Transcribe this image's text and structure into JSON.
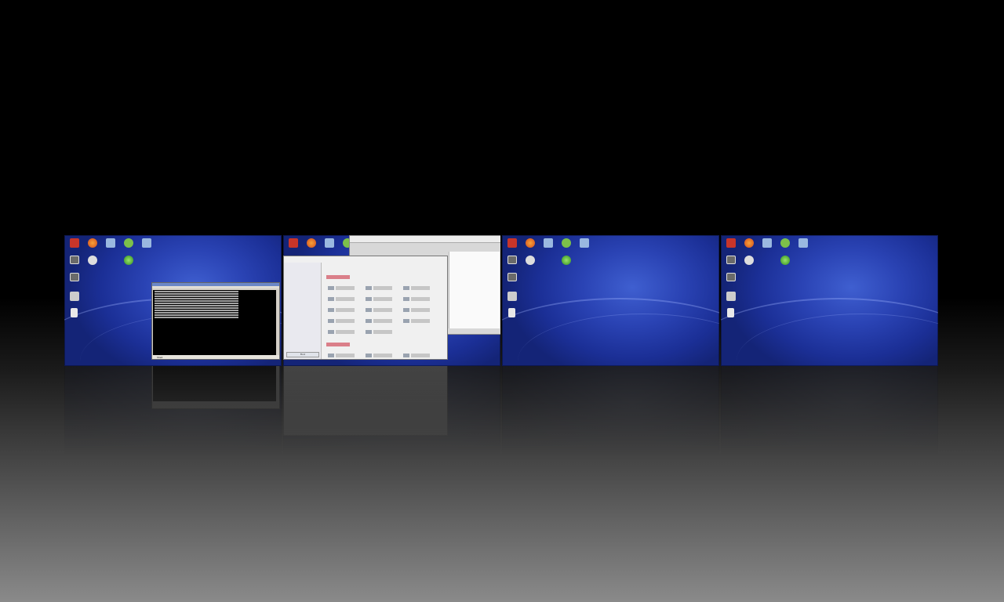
{
  "switcher": {
    "desktops": [
      {
        "id": "desktop-1",
        "icons": [
          "home-icon",
          "firefox-icon",
          "network-icon",
          "trash-icon",
          "cloud-icon",
          "computer-icon",
          "disc-icon",
          "globe-icon",
          "printer-icon",
          "document-icon"
        ],
        "window": {
          "type": "terminal",
          "status_label": "Shell"
        }
      },
      {
        "id": "desktop-2",
        "icons": [
          "home-icon",
          "firefox-icon",
          "network-icon",
          "trash-icon"
        ],
        "window": {
          "type": "settings",
          "find_label": "Find"
        }
      },
      {
        "id": "desktop-3",
        "icons": [
          "home-icon",
          "firefox-icon",
          "network-icon",
          "trash-icon",
          "cloud-icon",
          "computer-icon",
          "disc-icon",
          "globe-icon",
          "printer-icon",
          "document-icon"
        ]
      },
      {
        "id": "desktop-4",
        "icons": [
          "home-icon",
          "firefox-icon",
          "network-icon",
          "trash-icon",
          "cloud-icon",
          "computer-icon",
          "disc-icon",
          "globe-icon",
          "printer-icon",
          "document-icon"
        ]
      }
    ]
  },
  "colors": {
    "wallpaper": "#2a43b4",
    "background_top": "#000000",
    "background_bottom": "#8a8a8a"
  }
}
